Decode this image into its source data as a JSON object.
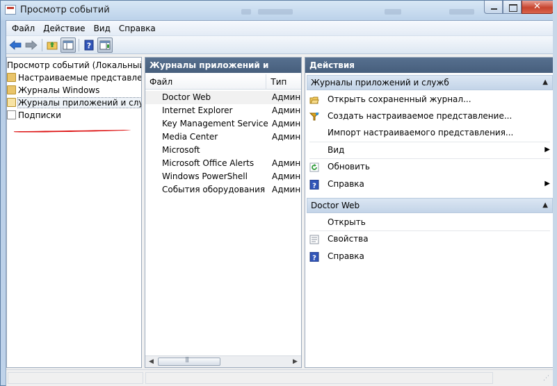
{
  "window": {
    "title": "Просмотр событий"
  },
  "menu": [
    "Файл",
    "Действие",
    "Вид",
    "Справка"
  ],
  "toolbar": {
    "icons": [
      "back-arrow-icon",
      "forward-arrow-icon",
      "folder-up-icon",
      "show-hide-tree-icon",
      "help-icon",
      "properties-pane-icon"
    ]
  },
  "tree": {
    "items": [
      {
        "label": "Просмотр событий (Локальный)",
        "icon": "event-viewer-icon",
        "indent": 0
      },
      {
        "label": "Настраиваемые представления",
        "icon": "folder-icon",
        "indent": 1
      },
      {
        "label": "Журналы Windows",
        "icon": "folder-icon",
        "indent": 1
      },
      {
        "label": "Журналы приложений и служб",
        "icon": "folder-open-icon",
        "indent": 1,
        "selected": true
      },
      {
        "label": "Подписки",
        "icon": "subscriptions-icon",
        "indent": 1
      }
    ]
  },
  "middle": {
    "header": "Журналы приложений и служб",
    "columns": [
      "Файл",
      "Тип"
    ],
    "rows": [
      {
        "name": "Doctor Web",
        "type": "Админ"
      },
      {
        "name": "Internet Explorer",
        "type": "Админ"
      },
      {
        "name": "Key Management Service",
        "type": "Админ"
      },
      {
        "name": "Media Center",
        "type": "Админ"
      },
      {
        "name": "Microsoft",
        "type": ""
      },
      {
        "name": "Microsoft Office Alerts",
        "type": "Админ"
      },
      {
        "name": "Windows PowerShell",
        "type": "Админ"
      },
      {
        "name": "События оборудования",
        "type": "Админ"
      }
    ]
  },
  "actions": {
    "header": "Действия",
    "section1": {
      "title": "Журналы приложений и служб",
      "items": [
        {
          "label": "Открыть сохраненный журнал...",
          "icon": "open-folder-icon",
          "submenu": false
        },
        {
          "label": "Создать настраиваемое представление...",
          "icon": "filter-icon",
          "submenu": false
        },
        {
          "label": "Импорт настраиваемого представления...",
          "icon": "",
          "submenu": false
        },
        {
          "label": "Вид",
          "icon": "",
          "submenu": true
        },
        {
          "label": "Обновить",
          "icon": "refresh-icon",
          "submenu": false
        },
        {
          "label": "Справка",
          "icon": "help-icon",
          "submenu": true
        }
      ]
    },
    "section2": {
      "title": "Doctor Web",
      "items": [
        {
          "label": "Открыть",
          "icon": ""
        },
        {
          "label": "Свойства",
          "icon": "properties-icon"
        },
        {
          "label": "Справка",
          "icon": "help-icon"
        }
      ]
    }
  },
  "colors": {
    "pane_header": "#4f6886",
    "section_header": "#cfdcec",
    "annotation_underline": "#dd1111"
  }
}
